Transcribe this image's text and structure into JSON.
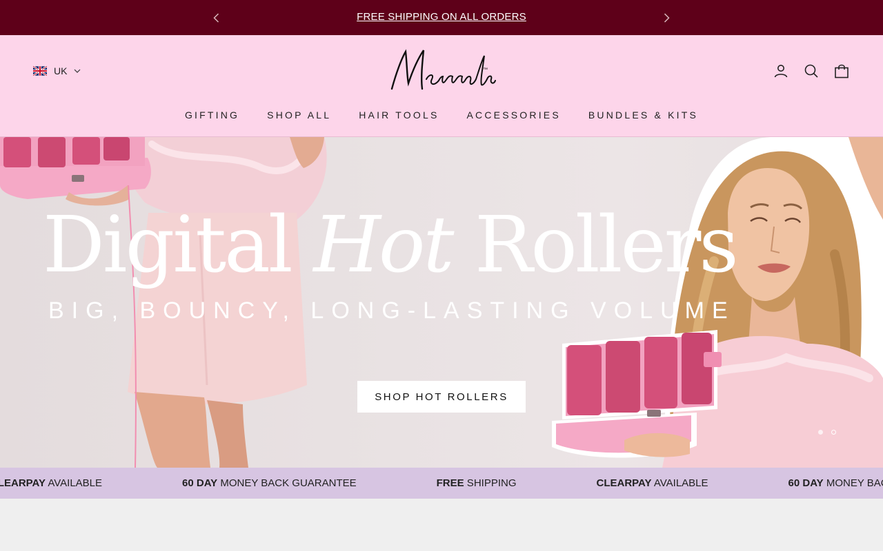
{
  "announcement": {
    "message": "FREE SHIPPING ON ALL ORDERS",
    "prev_icon": "chevron-left-icon",
    "next_icon": "chevron-right-icon"
  },
  "header": {
    "locale": {
      "flag": "uk-flag-icon",
      "label": "UK"
    },
    "logo_text": "Mermade™",
    "icons": [
      "account-icon",
      "search-icon",
      "cart-icon"
    ],
    "nav": [
      "GIFTING",
      "SHOP ALL",
      "HAIR TOOLS",
      "ACCESSORIES",
      "BUNDLES & KITS"
    ]
  },
  "hero": {
    "title_part1": "Digital ",
    "title_italic": "Hot",
    "title_part2": " Rollers",
    "subtitle": "BIG, BOUNCY, LONG-LASTING VOLUME",
    "cta_label": "SHOP HOT ROLLERS",
    "slides_count": 2,
    "active_slide": 2
  },
  "marquee": [
    {
      "bold": "CLEARPAY",
      "text": " AVAILABLE"
    },
    {
      "bold": "60 DAY",
      "text": " MONEY BACK GUARANTEE"
    },
    {
      "bold": "FREE",
      "text": " SHIPPING"
    },
    {
      "bold": "CLEARPAY",
      "text": " AVAILABLE"
    },
    {
      "bold": "60 DAY",
      "text": " MONEY BACK GUARANTEE"
    }
  ],
  "colors": {
    "announcement_bg": "#5e0019",
    "header_bg": "#fdd5ea",
    "marquee_bg": "#d7c5e2",
    "roller_pink": "#d4507a",
    "device_pink": "#f5a9c6"
  }
}
